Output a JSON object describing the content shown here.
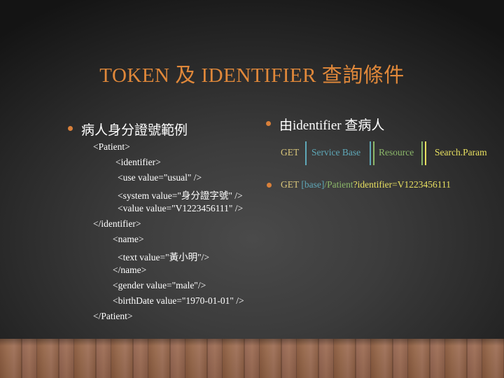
{
  "title": "TOKEN 及 IDENTIFIER 查詢條件",
  "colors": {
    "title": "#e0883a",
    "bullet": "#d9803a",
    "text": "#ffffff",
    "get": "#d8c57a",
    "service_base": "#5fa8b8",
    "resource": "#8cb86a",
    "search_param": "#e8e060"
  },
  "left": {
    "heading": "病人身分證號範例",
    "code_lines": [
      "<Patient>",
      "<identifier>",
      "<use value=\"usual\" />",
      "<system value=\"身分證字號\" />",
      "<value value=\"V1223456111\" />",
      "</identifier>",
      "<name>",
      "<text value=\"黃小明\"/>",
      "</name>",
      "<gender value=\"male\"/>",
      "<birthDate value=\"1970-01-01\" />",
      "</Patient>"
    ]
  },
  "right": {
    "heading": "由identifier 查病人",
    "url_parts": {
      "get": "GET",
      "service_base": "Service Base",
      "resource": "Resource",
      "search_param": "Search.Param"
    },
    "request": {
      "method": "GET ",
      "base": "[base]",
      "resource": "/Patient",
      "query": "?identifier=V1223456111"
    }
  }
}
